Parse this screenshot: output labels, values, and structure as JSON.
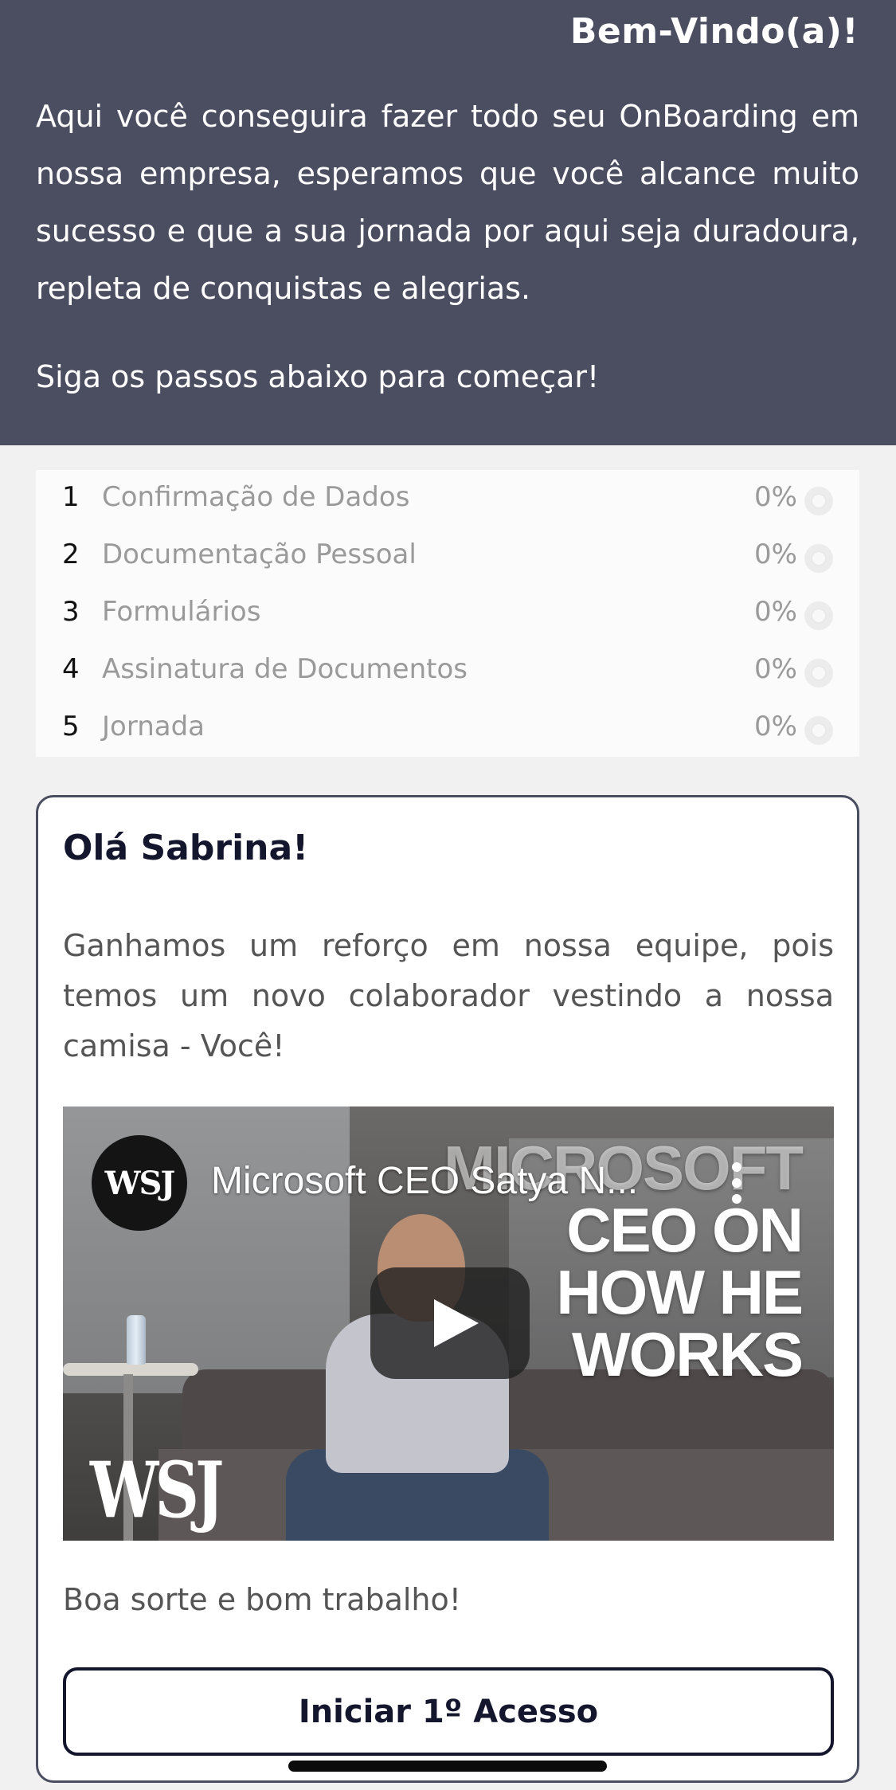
{
  "header": {
    "title": "Bem-Vindo(a)!",
    "intro": "Aqui você conseguira fazer todo seu OnBoarding em nossa empresa, esperamos que você alcance muito sucesso e que a sua jornada por aqui seja duradoura, repleta de conquistas e alegrias.",
    "cta": "Siga os passos abaixo para começar!"
  },
  "steps": [
    {
      "num": "1",
      "label": "Confirmação de Dados",
      "pct": "0%"
    },
    {
      "num": "2",
      "label": "Documentação Pessoal",
      "pct": "0%"
    },
    {
      "num": "3",
      "label": "Formulários",
      "pct": "0%"
    },
    {
      "num": "4",
      "label": "Assinatura de Documentos",
      "pct": "0%"
    },
    {
      "num": "5",
      "label": "Jornada",
      "pct": "0%"
    }
  ],
  "card": {
    "greeting": "Olá Sabrina!",
    "text": "Ganhamos um reforço em nossa equipe, pois temos um novo colaborador vestindo a nossa camisa - Você!",
    "video": {
      "channel_badge": "WSJ",
      "title": "Microsoft CEO Satya N...",
      "headline_1": "MICROSOFT",
      "headline_2": "CEO ON",
      "headline_3": "HOW HE",
      "headline_4": "WORKS",
      "watermark": "WSJ"
    },
    "closing": "Boa sorte e bom trabalho!",
    "button_label": "Iniciar 1º Acesso"
  },
  "colors": {
    "header_bg": "#4b4d60",
    "accent_dark": "#14162e",
    "page_bg": "#f1f1f2"
  },
  "icons": {
    "step_status": "empty-circle-icon",
    "play": "play-icon",
    "menu": "kebab-menu-icon"
  }
}
